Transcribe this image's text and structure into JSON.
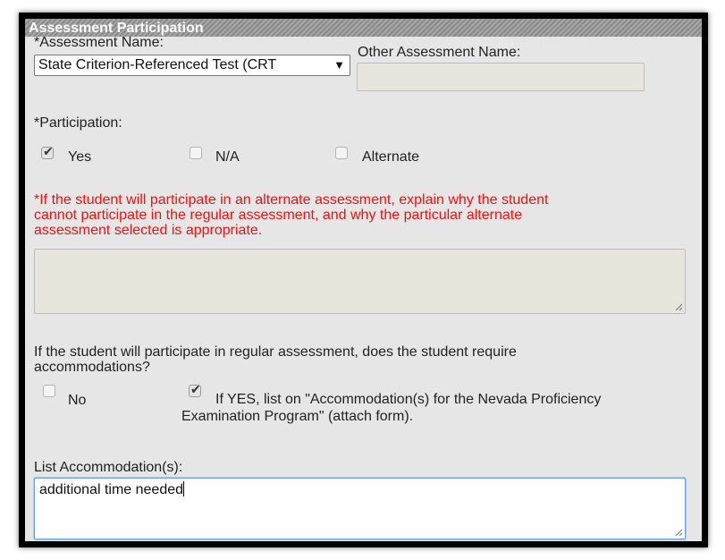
{
  "section_title": "Assessment Participation",
  "assessment_name": {
    "label": "*Assessment Name:",
    "selected": "State Criterion-Referenced Test (CRT",
    "arrow": "▼"
  },
  "other_assessment": {
    "label": "Other Assessment Name:",
    "value": ""
  },
  "participation": {
    "label": "*Participation:",
    "options": [
      {
        "label": "Yes",
        "checked": true
      },
      {
        "label": "N/A",
        "checked": false
      },
      {
        "label": "Alternate",
        "checked": false
      }
    ]
  },
  "alternate_explanation": {
    "label_lines": [
      "*If the student will participate in an alternate assessment, explain why the student",
      "cannot participate in the regular assessment, and why the particular alternate",
      "assessment selected is appropriate."
    ],
    "value": ""
  },
  "accommodations_question": {
    "label_lines": [
      "If the student will participate in regular assessment, does the student require",
      "accommodations?"
    ],
    "options": [
      {
        "label": "No",
        "checked": false
      },
      {
        "label_lines": [
          "If YES, list on \"Accommodation(s) for the Nevada Proficiency",
          "Examination Program\" (attach form)."
        ],
        "checked": true
      }
    ]
  },
  "list_accommodations": {
    "label": "List Accommodation(s):",
    "value": "additional time needed"
  },
  "icons": {
    "checkmark": "✔",
    "resize_grip": "resize-grip-icon"
  }
}
